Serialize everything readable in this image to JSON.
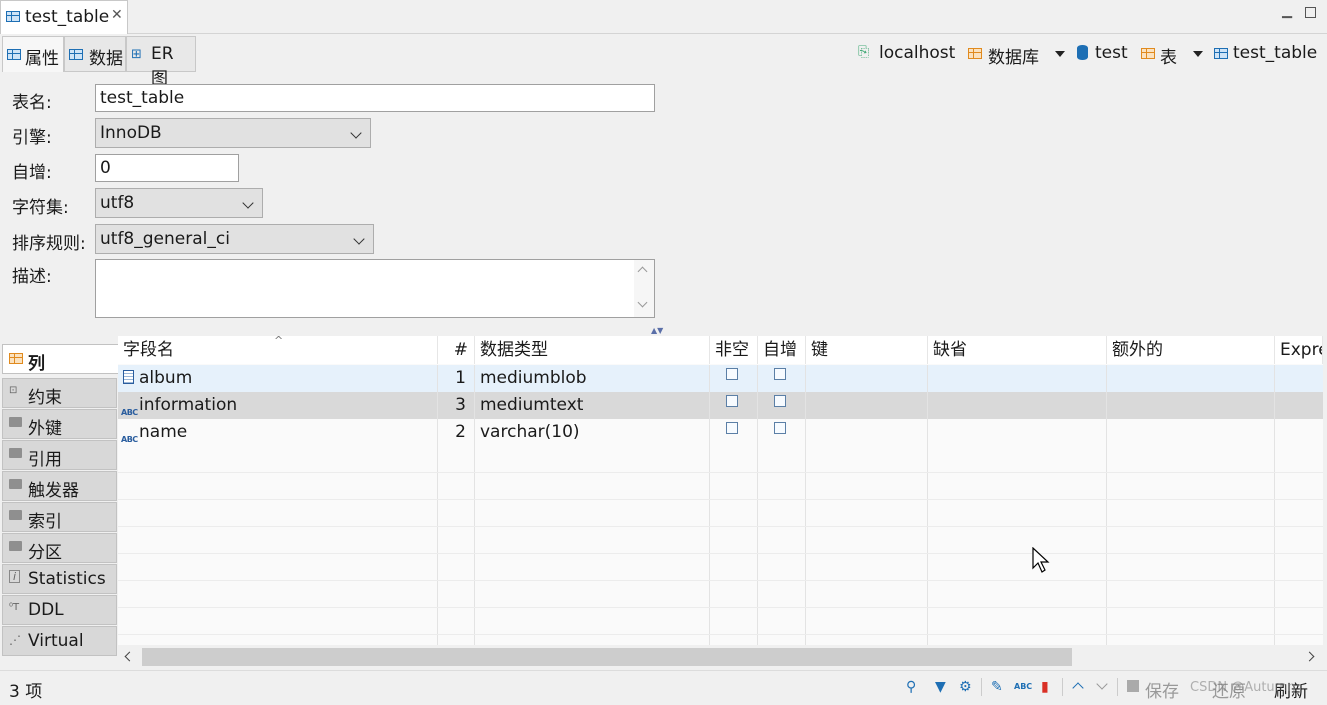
{
  "editor_tab": {
    "title": "test_table",
    "close": "✕"
  },
  "subtabs": {
    "properties": "属性",
    "data": "数据",
    "er": "ER 图"
  },
  "breadcrumb": {
    "host": "localhost",
    "databases": "数据库",
    "db": "test",
    "tables": "表",
    "table": "test_table"
  },
  "form": {
    "table_name_label": "表名:",
    "table_name": "test_table",
    "engine_label": "引擎:",
    "engine": "InnoDB",
    "auto_inc_label": "自增:",
    "auto_inc": "0",
    "charset_label": "字符集:",
    "charset": "utf8",
    "collation_label": "排序规则:",
    "collation": "utf8_general_ci",
    "description_label": "描述:",
    "description": ""
  },
  "sidebar": {
    "items": [
      {
        "label": "列",
        "icon": "columns-icon"
      },
      {
        "label": "约束",
        "icon": "constraint-icon"
      },
      {
        "label": "外键",
        "icon": "folder-icon"
      },
      {
        "label": "引用",
        "icon": "folder-icon"
      },
      {
        "label": "触发器",
        "icon": "folder-icon"
      },
      {
        "label": "索引",
        "icon": "folder-icon"
      },
      {
        "label": "分区",
        "icon": "folder-icon"
      },
      {
        "label": "Statistics",
        "icon": "info-icon"
      },
      {
        "label": "DDL",
        "icon": "ddl-icon"
      },
      {
        "label": "Virtual",
        "icon": "virtual-icon"
      }
    ]
  },
  "grid": {
    "headers": {
      "name": "字段名",
      "num": "#",
      "type": "数据类型",
      "notnull": "非空",
      "autoinc": "自增",
      "key": "键",
      "default": "缺省",
      "extra": "额外的",
      "expr": "Expre"
    },
    "rows": [
      {
        "name": "album",
        "num": "1",
        "type": "mediumblob",
        "type_icon": "blob-icon"
      },
      {
        "name": "information",
        "num": "3",
        "type": "mediumtext",
        "type_icon": "abc-icon"
      },
      {
        "name": "name",
        "num": "2",
        "type": "varchar(10)",
        "type_icon": "abc-icon"
      }
    ],
    "abc": "ABC"
  },
  "status": {
    "count": "3 项",
    "save": "保存",
    "revert": "还原",
    "refresh": "刷新",
    "abc": "ABC",
    "watermark": "CSDN @Autumn"
  }
}
